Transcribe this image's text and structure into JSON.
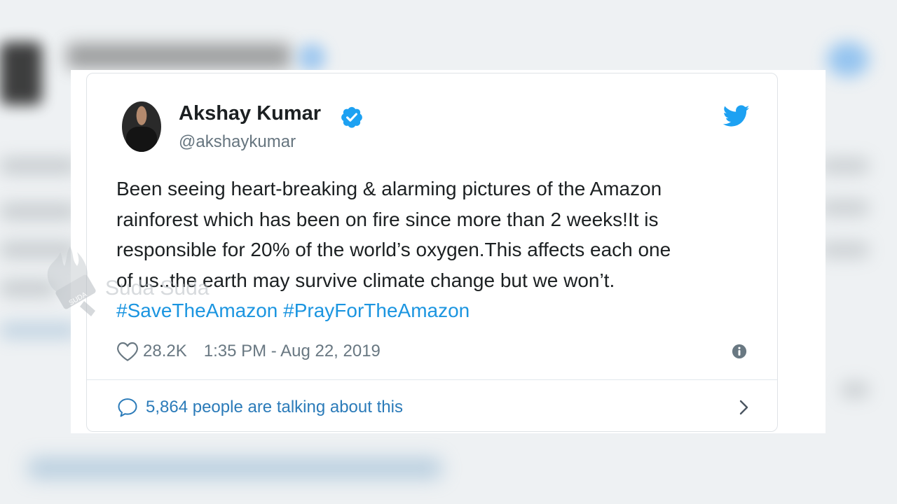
{
  "author": {
    "display_name": "Akshay Kumar",
    "handle": "@akshaykumar",
    "verified": true
  },
  "tweet": {
    "lines": [
      "Been seeing heart-breaking & alarming pictures of the Amazon",
      "rainforest which has been on fire since more than 2 weeks!It is",
      "responsible for 20% of the world’s oxygen.This affects each one",
      "of us..the earth may survive climate change but we won’t."
    ],
    "hashtags": [
      "#SaveTheAmazon",
      "#PrayForTheAmazon"
    ]
  },
  "meta": {
    "likes": "28.2K",
    "timestamp": "1:35 PM - Aug 22, 2019"
  },
  "talking": {
    "label": "5,864 people are talking about this"
  },
  "watermark": {
    "text": "Suda Suda",
    "logo_text": "SUDA"
  },
  "colors": {
    "accent": "#1da1f2",
    "link": "#2b7bb9",
    "text": "#1c2022",
    "muted": "#697882"
  },
  "icons": [
    "verified-badge-icon",
    "twitter-bird-icon",
    "heart-icon",
    "info-icon",
    "comment-icon",
    "chevron-right-icon"
  ]
}
